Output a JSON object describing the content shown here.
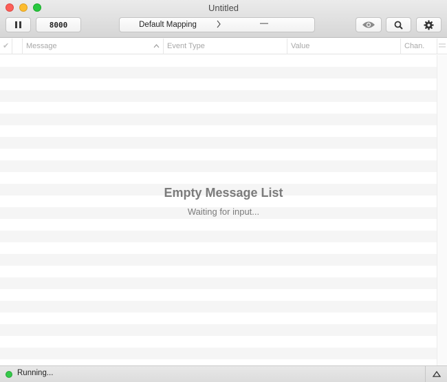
{
  "window": {
    "title": "Untitled"
  },
  "toolbar": {
    "port_label": "8000",
    "mapping_label": "Default Mapping",
    "mapping_secondary": "—"
  },
  "table": {
    "columns": {
      "check": "✔",
      "message": "Message",
      "event_type": "Event Type",
      "value": "Value",
      "channel": "Chan."
    }
  },
  "empty_state": {
    "title": "Empty Message List",
    "subtitle": "Waiting for input..."
  },
  "status": {
    "text": "Running...",
    "indicator_color": "#35c94a"
  },
  "icons": {
    "pause": "pause-icon",
    "eye": "eye-icon",
    "search": "search-icon",
    "gear": "gear-icon",
    "chevron_right": "chevron-right-icon",
    "sort": "chevron-up-icon",
    "triangle_up": "triangle-up-icon"
  }
}
